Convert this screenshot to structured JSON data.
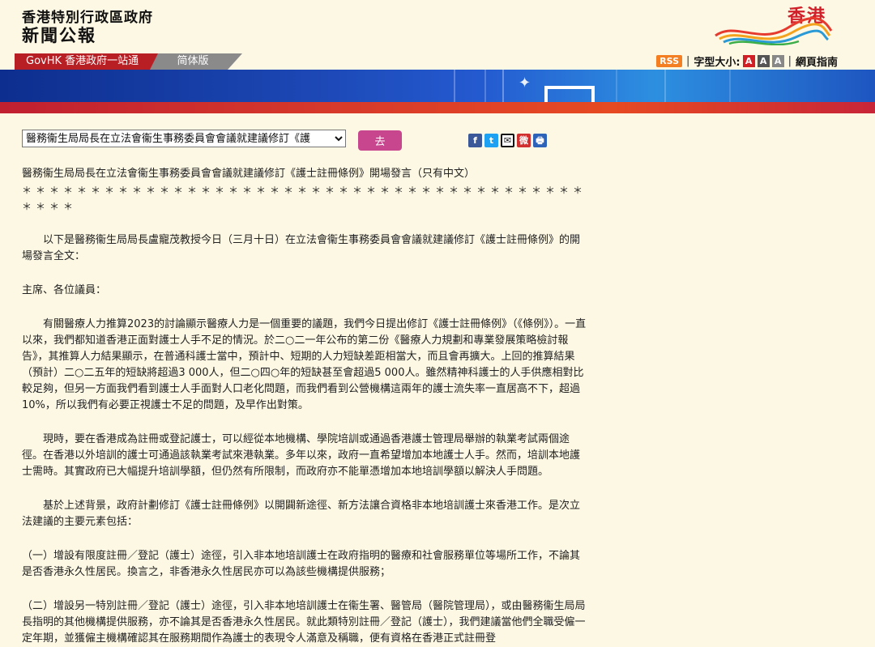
{
  "header": {
    "gov_name": "香港特別行政區政府",
    "bulletin": "新聞公報",
    "brand": "香港"
  },
  "nav": {
    "govhk": "GovHK 香港政府一站通",
    "simplified": "简体版",
    "rss": "RSS",
    "font_size_label": "字型大小:",
    "font_a": "A",
    "guide": "網頁指南"
  },
  "toolbar": {
    "selected_story": "醫務衞生局局長在立法會衞生事務委員會會議就建議修訂《護",
    "go": "去"
  },
  "share": {
    "facebook": "f",
    "twitter": "t",
    "email": "✉",
    "weibo": "微",
    "print": "🖶"
  },
  "article": {
    "title": "醫務衞生局局長在立法會衞生事務委員會會議就建議修訂《護士註冊條例》開場發言（只有中文）",
    "stars": "＊＊＊＊＊＊＊＊＊＊＊＊＊＊＊＊＊＊＊＊＊＊＊＊＊＊＊＊＊＊＊＊＊＊＊＊＊＊＊＊＊＊＊＊＊",
    "intro": "以下是醫務衞生局局長盧寵茂教授今日（三月十日）在立法會衞生事務委員會會議就建議修訂《護士註冊條例》的開場發言全文：",
    "salutation": "主席、各位議員：",
    "p1": "有關醫療人力推算2023的討論顯示醫療人力是一個重要的議題，我們今日提出修訂《護士註冊條例》（《條例》）。一直以來，我們都知道香港正面對護士人手不足的情況。於二○二一年公布的第二份《醫療人力規劃和專業發展策略檢討報告》，其推算人力結果顯示，在普通科護士當中，預計中、短期的人力短缺差距相當大，而且會再擴大。上回的推算結果（預計）二○二五年的短缺將超過3 000人，但二○四○年的短缺甚至會超過5 000人。雖然精神科護士的人手供應相對比較足夠，但另一方面我們看到護士人手面對人口老化問題，而我們看到公營機構這兩年的護士流失率一直居高不下，超過10%，所以我們有必要正視護士不足的問題，及早作出對策。",
    "p2": "現時，要在香港成為註冊或登記護士，可以經從本地機構、學院培訓或通過香港護士管理局舉辦的執業考試兩個途徑。在香港以外培訓的護士可通過該執業考試來港執業。多年以來，政府一直希望增加本地護士人手。然而，培訓本地護士需時。其實政府已大幅提升培訓學額，但仍然有所限制，而政府亦不能單憑增加本地培訓學額以解決人手問題。",
    "p3": "基於上述背景，政府計劃修訂《護士註冊條例》以開闢新途徑、新方法讓合資格非本地培訓護士來香港工作。是次立法建議的主要元素包括：",
    "p4": "（一）增設有限度註冊／登記（護士）途徑，引入非本地培訓護士在政府指明的醫療和社會服務單位等場所工作，不論其是否香港永久性居民。換言之，非香港永久性居民亦可以為該些機構提供服務；",
    "p5": "（二）增設另一特別註冊／登記（護士）途徑，引入非本地培訓護士在衞生署、醫管局（醫院管理局），或由醫務衞生局局長指明的其他機構提供服務，亦不論其是否香港永久性居民。就此類特別註冊／登記（護士），我們建議當他們全職受僱一定年期，並獲僱主機構確認其在服務期間作為護士的表現令人滿意及稱職，便有資格在香港正式註冊登"
  }
}
